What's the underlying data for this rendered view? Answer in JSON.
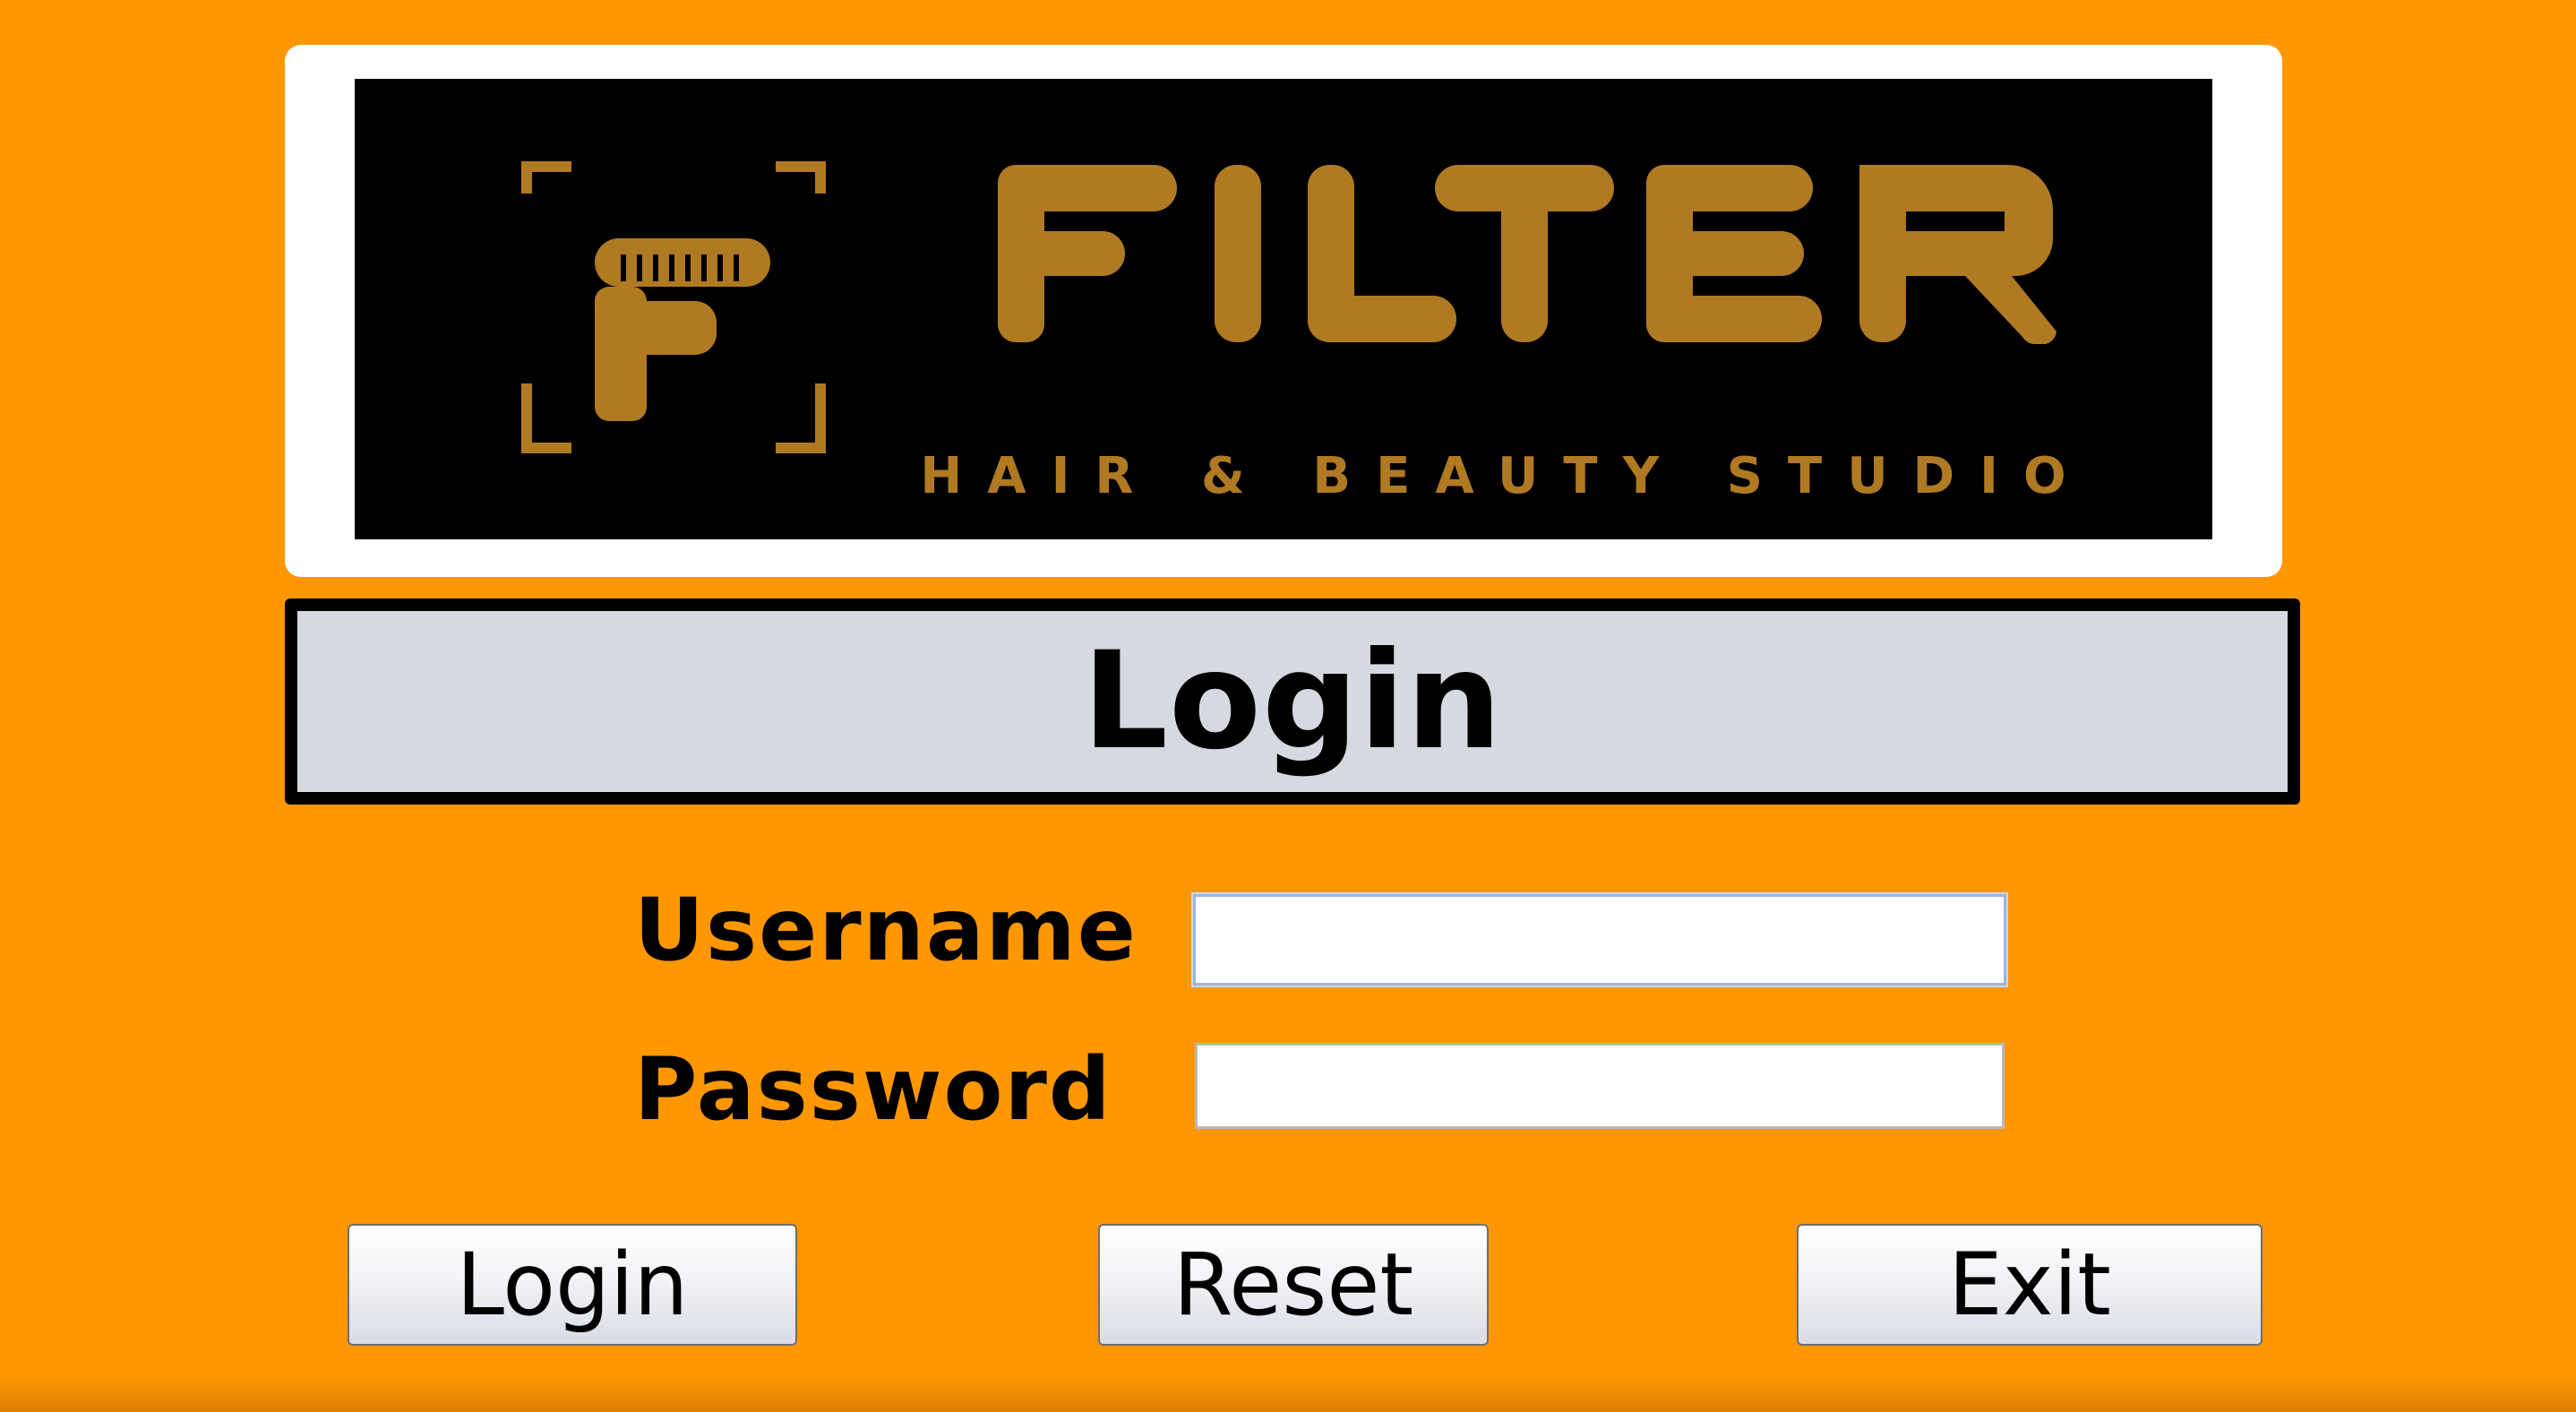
{
  "logo": {
    "brand_name": "FILTER",
    "tagline": "HAIR & BEAUTY STUDIO",
    "colors": {
      "panel": "#000000",
      "gold": "#b07a22",
      "frame": "#ffffff"
    }
  },
  "title": {
    "text": "Login"
  },
  "form": {
    "username_label": "Username",
    "username_value": "",
    "password_label": "Password",
    "password_value": ""
  },
  "buttons": {
    "login": "Login",
    "reset": "Reset",
    "exit": "Exit"
  },
  "theme": {
    "background": "#fe9702",
    "title_bar": "#d6d9e0"
  }
}
